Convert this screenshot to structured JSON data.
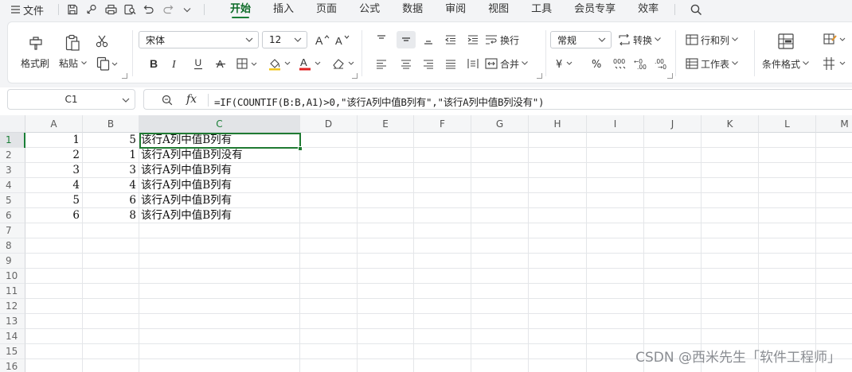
{
  "menu": {
    "file_label": "文件",
    "tabs": [
      {
        "label": "开始",
        "active": true
      },
      {
        "label": "插入",
        "active": false
      },
      {
        "label": "页面",
        "active": false
      },
      {
        "label": "公式",
        "active": false
      },
      {
        "label": "数据",
        "active": false
      },
      {
        "label": "审阅",
        "active": false
      },
      {
        "label": "视图",
        "active": false
      },
      {
        "label": "工具",
        "active": false
      },
      {
        "label": "会员专享",
        "active": false
      },
      {
        "label": "效率",
        "active": false
      }
    ]
  },
  "ribbon": {
    "clipboard": {
      "format_painter": "格式刷",
      "paste": "粘贴"
    },
    "font": {
      "name": "宋体",
      "size": "12"
    },
    "alignment": {
      "wrap": "换行",
      "merge": "合并"
    },
    "number": {
      "format": "常规",
      "convert": "转换"
    },
    "cells": {
      "rows_cols": "行和列",
      "worksheet": "工作表"
    },
    "styles": {
      "conditional_format": "条件格式"
    }
  },
  "formula_bar": {
    "cell_ref": "C1",
    "fx": "fx",
    "formula": "=IF(COUNTIF(B:B,A1)>0,\"该行A列中值B列有\",\"该行A列中值B列没有\")"
  },
  "sheet": {
    "columns": [
      "A",
      "B",
      "C",
      "D",
      "E",
      "F",
      "G",
      "H",
      "I",
      "J",
      "K",
      "L",
      "M"
    ],
    "active_column": "C",
    "active_row": "1",
    "row_numbers": [
      "1",
      "2",
      "3",
      "4",
      "5",
      "6",
      "7",
      "8",
      "9",
      "10",
      "11",
      "12",
      "13",
      "14",
      "15",
      "16"
    ],
    "rows": [
      {
        "a": "1",
        "b": "5",
        "c": "该行A列中值B列有"
      },
      {
        "a": "2",
        "b": "1",
        "c": "该行A列中值B列没有"
      },
      {
        "a": "3",
        "b": "3",
        "c": "该行A列中值B列有"
      },
      {
        "a": "4",
        "b": "4",
        "c": "该行A列中值B列有"
      },
      {
        "a": "5",
        "b": "6",
        "c": "该行A列中值B列有"
      },
      {
        "a": "6",
        "b": "8",
        "c": "该行A列中值B列有"
      }
    ]
  },
  "watermark": "CSDN @西米先生「软件工程师」",
  "colors": {
    "accent": "#1a7f37",
    "selection": "#1f7a32",
    "font_color_bar": "#e02020"
  },
  "icons": [
    "menu-icon",
    "save-icon",
    "share-icon",
    "print-icon",
    "print-preview-icon",
    "undo-icon",
    "redo-icon",
    "search-icon"
  ]
}
